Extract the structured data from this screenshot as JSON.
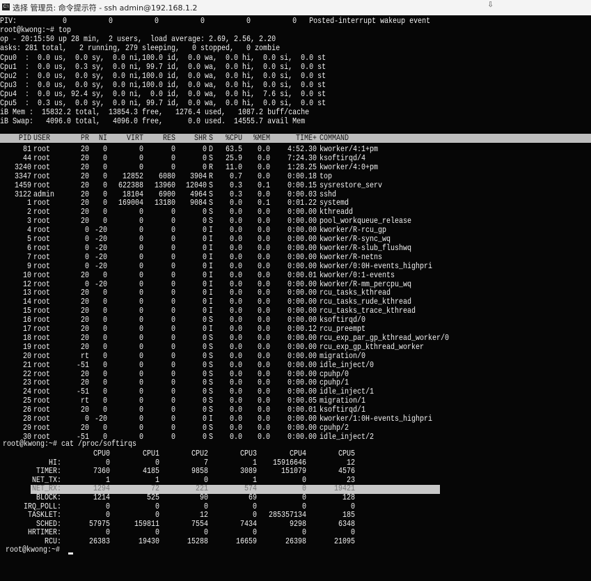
{
  "window": {
    "title": "选择 管理员: 命令提示符 - ssh  admin@192.168.1.2",
    "icon": "cmd-icon"
  },
  "summary_lines": [
    "PIV:           0          0          0          0          0          0   Posted-interrupt wakeup event",
    "root@kwong:~# top",
    "op - 20:15:50 up 28 min,  2 users,  load average: 2.69, 2.56, 2.20",
    "asks: 281 total,   2 running, 279 sleeping,   0 stopped,   0 zombie",
    "Cpu0  :  0.0 us,  0.0 sy,  0.0 ni,100.0 id,  0.0 wa,  0.0 hi,  0.0 si,  0.0 st",
    "Cpu1  :  0.0 us,  0.3 sy,  0.0 ni, 99.7 id,  0.0 wa,  0.0 hi,  0.0 si,  0.0 st",
    "Cpu2  :  0.0 us,  0.0 sy,  0.0 ni,100.0 id,  0.0 wa,  0.0 hi,  0.0 si,  0.0 st",
    "Cpu3  :  0.0 us,  0.0 sy,  0.0 ni,100.0 id,  0.0 wa,  0.0 hi,  0.0 si,  0.0 st",
    "Cpu4  :  0.0 us, 92.4 sy,  0.0 ni,  0.0 id,  0.0 wa,  0.0 hi,  7.6 si,  0.0 st",
    "Cpu5  :  0.3 us,  0.0 sy,  0.0 ni, 99.7 id,  0.0 wa,  0.0 hi,  0.0 si,  0.0 st",
    "iB Mem :  15832.2 total,  13854.3 free,   1276.4 used,   1087.2 buff/cache",
    "iB Swap:   4096.0 total,   4096.0 free,      0.0 used.  14555.7 avail Mem"
  ],
  "process_table": {
    "columns": [
      "PID",
      "USER",
      "PR",
      "NI",
      "VIRT",
      "RES",
      "SHR",
      "S",
      "%CPU",
      "%MEM",
      "TIME+",
      "COMMAND"
    ],
    "rows": [
      [
        "81",
        "root",
        "20",
        "0",
        "0",
        "0",
        "0",
        "D",
        "63.5",
        "0.0",
        "4:52.30",
        "kworker/4:1+pm"
      ],
      [
        "44",
        "root",
        "20",
        "0",
        "0",
        "0",
        "0",
        "S",
        "25.9",
        "0.0",
        "7:24.30",
        "ksoftirqd/4"
      ],
      [
        "3240",
        "root",
        "20",
        "0",
        "0",
        "0",
        "0",
        "R",
        "11.0",
        "0.0",
        "1:28.25",
        "kworker/4:0+pm"
      ],
      [
        "3347",
        "root",
        "20",
        "0",
        "12852",
        "6080",
        "3904",
        "R",
        "0.7",
        "0.0",
        "0:00.18",
        "top"
      ],
      [
        "1459",
        "root",
        "20",
        "0",
        "622388",
        "13960",
        "12040",
        "S",
        "0.3",
        "0.1",
        "0:00.15",
        "sysrestore_serv"
      ],
      [
        "3122",
        "admin",
        "20",
        "0",
        "18104",
        "6900",
        "4964",
        "S",
        "0.3",
        "0.0",
        "0:00.03",
        "sshd"
      ],
      [
        "1",
        "root",
        "20",
        "0",
        "169004",
        "13180",
        "9084",
        "S",
        "0.0",
        "0.1",
        "0:01.22",
        "systemd"
      ],
      [
        "2",
        "root",
        "20",
        "0",
        "0",
        "0",
        "0",
        "S",
        "0.0",
        "0.0",
        "0:00.00",
        "kthreadd"
      ],
      [
        "3",
        "root",
        "20",
        "0",
        "0",
        "0",
        "0",
        "S",
        "0.0",
        "0.0",
        "0:00.00",
        "pool_workqueue_release"
      ],
      [
        "4",
        "root",
        "0",
        "-20",
        "0",
        "0",
        "0",
        "I",
        "0.0",
        "0.0",
        "0:00.00",
        "kworker/R-rcu_gp"
      ],
      [
        "5",
        "root",
        "0",
        "-20",
        "0",
        "0",
        "0",
        "I",
        "0.0",
        "0.0",
        "0:00.00",
        "kworker/R-sync_wq"
      ],
      [
        "6",
        "root",
        "0",
        "-20",
        "0",
        "0",
        "0",
        "I",
        "0.0",
        "0.0",
        "0:00.00",
        "kworker/R-slub_flushwq"
      ],
      [
        "7",
        "root",
        "0",
        "-20",
        "0",
        "0",
        "0",
        "I",
        "0.0",
        "0.0",
        "0:00.00",
        "kworker/R-netns"
      ],
      [
        "9",
        "root",
        "0",
        "-20",
        "0",
        "0",
        "0",
        "I",
        "0.0",
        "0.0",
        "0:00.00",
        "kworker/0:0H-events_highpri"
      ],
      [
        "10",
        "root",
        "20",
        "0",
        "0",
        "0",
        "0",
        "I",
        "0.0",
        "0.0",
        "0:00.01",
        "kworker/0:1-events"
      ],
      [
        "12",
        "root",
        "0",
        "-20",
        "0",
        "0",
        "0",
        "I",
        "0.0",
        "0.0",
        "0:00.00",
        "kworker/R-mm_percpu_wq"
      ],
      [
        "13",
        "root",
        "20",
        "0",
        "0",
        "0",
        "0",
        "I",
        "0.0",
        "0.0",
        "0:00.00",
        "rcu_tasks_kthread"
      ],
      [
        "14",
        "root",
        "20",
        "0",
        "0",
        "0",
        "0",
        "I",
        "0.0",
        "0.0",
        "0:00.00",
        "rcu_tasks_rude_kthread"
      ],
      [
        "15",
        "root",
        "20",
        "0",
        "0",
        "0",
        "0",
        "I",
        "0.0",
        "0.0",
        "0:00.00",
        "rcu_tasks_trace_kthread"
      ],
      [
        "16",
        "root",
        "20",
        "0",
        "0",
        "0",
        "0",
        "S",
        "0.0",
        "0.0",
        "0:00.00",
        "ksoftirqd/0"
      ],
      [
        "17",
        "root",
        "20",
        "0",
        "0",
        "0",
        "0",
        "I",
        "0.0",
        "0.0",
        "0:00.12",
        "rcu_preempt"
      ],
      [
        "18",
        "root",
        "20",
        "0",
        "0",
        "0",
        "0",
        "S",
        "0.0",
        "0.0",
        "0:00.00",
        "rcu_exp_par_gp_kthread_worker/0"
      ],
      [
        "19",
        "root",
        "20",
        "0",
        "0",
        "0",
        "0",
        "S",
        "0.0",
        "0.0",
        "0:00.00",
        "rcu_exp_gp_kthread_worker"
      ],
      [
        "20",
        "root",
        "rt",
        "0",
        "0",
        "0",
        "0",
        "S",
        "0.0",
        "0.0",
        "0:00.00",
        "migration/0"
      ],
      [
        "21",
        "root",
        "-51",
        "0",
        "0",
        "0",
        "0",
        "S",
        "0.0",
        "0.0",
        "0:00.00",
        "idle_inject/0"
      ],
      [
        "22",
        "root",
        "20",
        "0",
        "0",
        "0",
        "0",
        "S",
        "0.0",
        "0.0",
        "0:00.00",
        "cpuhp/0"
      ],
      [
        "23",
        "root",
        "20",
        "0",
        "0",
        "0",
        "0",
        "S",
        "0.0",
        "0.0",
        "0:00.00",
        "cpuhp/1"
      ],
      [
        "24",
        "root",
        "-51",
        "0",
        "0",
        "0",
        "0",
        "S",
        "0.0",
        "0.0",
        "0:00.00",
        "idle_inject/1"
      ],
      [
        "25",
        "root",
        "rt",
        "0",
        "0",
        "0",
        "0",
        "S",
        "0.0",
        "0.0",
        "0:00.05",
        "migration/1"
      ],
      [
        "26",
        "root",
        "20",
        "0",
        "0",
        "0",
        "0",
        "S",
        "0.0",
        "0.0",
        "0:00.01",
        "ksoftirqd/1"
      ],
      [
        "28",
        "root",
        "0",
        "-20",
        "0",
        "0",
        "0",
        "I",
        "0.0",
        "0.0",
        "0:00.00",
        "kworker/1:0H-events_highpri"
      ],
      [
        "29",
        "root",
        "20",
        "0",
        "0",
        "0",
        "0",
        "S",
        "0.0",
        "0.0",
        "0:00.00",
        "cpuhp/2"
      ],
      [
        "30",
        "root",
        "-51",
        "0",
        "0",
        "0",
        "0",
        "S",
        "0.0",
        "0.0",
        "0:00.00",
        "idle_inject/2"
      ]
    ]
  },
  "softirqs": {
    "command": "root@kwong:~# cat /proc/softirqs",
    "columns": [
      "",
      "CPU0",
      "CPU1",
      "CPU2",
      "CPU3",
      "CPU4",
      "CPU5"
    ],
    "rows": [
      [
        "HI:",
        "0",
        "0",
        "7",
        "1",
        "15916646",
        "12"
      ],
      [
        "TIMER:",
        "7360",
        "4185",
        "9858",
        "3089",
        "151079",
        "4576"
      ],
      [
        "NET_TX:",
        "1",
        "1",
        "0",
        "1",
        "0",
        "23"
      ],
      [
        "NET_RX:",
        "1294",
        "72",
        "221",
        "574",
        "0",
        "19421"
      ],
      [
        "BLOCK:",
        "1214",
        "525",
        "90",
        "69",
        "0",
        "128"
      ],
      [
        "IRQ_POLL:",
        "0",
        "0",
        "0",
        "0",
        "0",
        "0"
      ],
      [
        "TASKLET:",
        "0",
        "0",
        "12",
        "0",
        "285357134",
        "185"
      ],
      [
        "SCHED:",
        "57975",
        "159811",
        "7554",
        "7434",
        "9298",
        "6348"
      ],
      [
        "HRTIMER:",
        "0",
        "0",
        "0",
        "0",
        "0",
        "0"
      ],
      [
        "RCU:",
        "26383",
        "19430",
        "15288",
        "16659",
        "26398",
        "21095"
      ]
    ],
    "selected_row": "NET_RX:"
  },
  "prompt": "root@kwong:~# "
}
